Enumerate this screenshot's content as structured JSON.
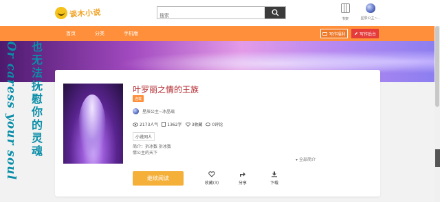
{
  "header": {
    "logo_text": "谈木小说",
    "search": {
      "placeholder": "搜索",
      "value": ""
    },
    "shelf_label": "书架",
    "user_name": "星辰公主~..."
  },
  "nav": {
    "items": [
      "首页",
      "分类",
      "手机版"
    ],
    "write_benefit": "写作福利",
    "write_backend": "写作后台"
  },
  "decor": {
    "english": "Or caress your soul",
    "chinese": "也无法抚慰你的灵魂"
  },
  "book": {
    "title": "叶罗丽之情的王族",
    "status": "连载",
    "author": "星辰公主~冰晶璃",
    "stats": {
      "popularity": "2173人气",
      "words": "1362字",
      "favorites": "3收藏",
      "comments": "0评论"
    },
    "category": "小说同人",
    "intro_line1": "简介：拆冰数 拆冰数",
    "intro_line2": "情公主的天下",
    "expand_label": "全部简介",
    "read_button": "继续阅读",
    "actions": {
      "collect": "收藏(3)",
      "share": "分享",
      "download": "下载"
    }
  },
  "colors": {
    "nav": "#ff8f3a",
    "title": "#b2262c",
    "read_button": "#f5b03a",
    "backend_button": "#e53b3b",
    "decor_text": "#0a8ea8"
  }
}
